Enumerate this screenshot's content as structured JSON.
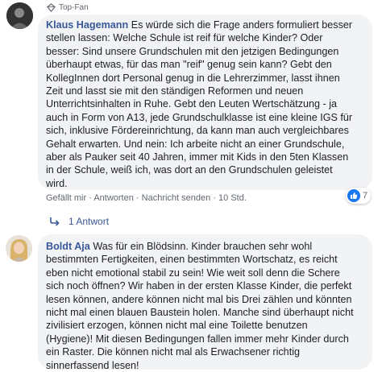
{
  "comment1": {
    "badge": "Top-Fan",
    "author": "Klaus Hagemann",
    "text": "Es würde sich die Frage anders formuliert besser\nstellen lassen: Welche Schule ist reif für welche Kinder? Oder\nbesser: Sind unsere Grundschulen mit den jetzigen Bedingungen\nüberhaupt etwas, für das man \"reif\" genug sein kann? Gebt den\nKollegInnen dort Personal genug in die Lehrerzimmer, lasst ihnen\nZeit und lasst sie mit den ständigen Reformen und neuen\nUnterrichtsinhalten in Ruhe. Gebt den Leuten Wertschätzung - ja\nauch in Form von A13, jede Grundschulklasse ist eine kleine IGS für\nsich, inklusive Fördereinrichtung, da kann man auch vergleichbares\nGehalt erwarten. Und nein: Ich arbeite nicht an einer Grundschule,\naber als Pauker seit 40 Jahren, immer mit Kids in den 5ten Klassen\nin der Schule, weiß ich, was dort an den Grundschulen geleistet\nwird.",
    "actions": {
      "like": "Gefällt mir",
      "reply": "Antworten",
      "message": "Nachricht senden",
      "time": "10 Std."
    },
    "sep": "·",
    "reaction_count": "7",
    "replies_label": "1 Antwort"
  },
  "comment2": {
    "author": "Boldt Aja",
    "text": "Was für ein Blödsinn. Kinder brauchen sehr wohl\nbestimmten Fertigkeiten, einen bestimmten Wortschatz, es reicht\neben nicht emotional stabil zu sein! Wie weit soll denn die Schere\nsich noch öffnen? Wir haben in der ersten Klasse Kinder, die perfekt\nlesen können, andere können nicht mal bis Drei zählen und könnten\nnicht mal einen blauen Baustein holen. Manche sind überhaupt nicht\nzivilisiert erzogen, können nicht mal eine Toilette benutzen\n(Hygiene)! Mit diesen Bedingungen fallen immer mehr Kinder durch\nein Raster. Die können nicht mal als Erwachsener richtig\nsinnerfassend lesen!"
  },
  "colors": {
    "link": "#385898",
    "bubble": "#f2f3f5",
    "like_blue": "#1877f2"
  },
  "icons": [
    "top-fan-diamond-icon",
    "like-thumb-icon",
    "reply-arrow-icon"
  ]
}
